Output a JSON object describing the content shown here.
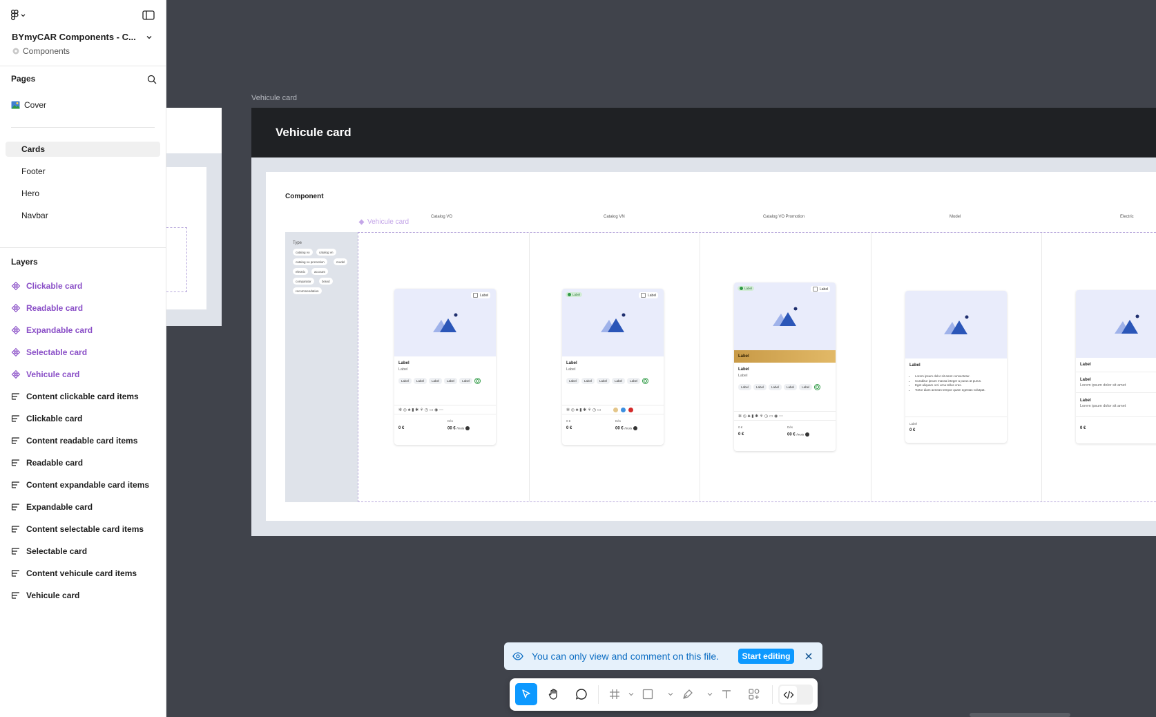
{
  "file": {
    "title": "BYmyCAR Components - C...",
    "subtitle": "Components"
  },
  "pages": {
    "header": "Pages",
    "items": [
      {
        "label": "Cover"
      },
      {
        "label": "Cards"
      },
      {
        "label": "Footer"
      },
      {
        "label": "Hero"
      },
      {
        "label": "Navbar"
      }
    ]
  },
  "layers": {
    "header": "Layers",
    "items": [
      {
        "label": "Clickable card",
        "kind": "component"
      },
      {
        "label": "Readable card",
        "kind": "component"
      },
      {
        "label": "Expandable card",
        "kind": "component"
      },
      {
        "label": "Selectable card",
        "kind": "component"
      },
      {
        "label": "Vehicule card",
        "kind": "component"
      },
      {
        "label": "Content clickable card items",
        "kind": "frame"
      },
      {
        "label": "Clickable card",
        "kind": "frame"
      },
      {
        "label": "Content readable card items",
        "kind": "frame"
      },
      {
        "label": "Readable card",
        "kind": "frame"
      },
      {
        "label": "Content expandable card items",
        "kind": "frame"
      },
      {
        "label": "Expandable card",
        "kind": "frame"
      },
      {
        "label": "Content selectable card items",
        "kind": "frame"
      },
      {
        "label": "Selectable card",
        "kind": "frame"
      },
      {
        "label": "Content vehicule card items",
        "kind": "frame"
      },
      {
        "label": "Vehicule card",
        "kind": "frame"
      }
    ]
  },
  "canvas": {
    "frame_label": "Vehicule card",
    "frame_title": "Vehicule card",
    "component_label": "Component",
    "variant_label": "Vehicule card",
    "columns": [
      "Catalog VO",
      "Catalog VN",
      "Catalog VO Promotion",
      "Model",
      "Electric"
    ],
    "type_panel": {
      "title": "Type",
      "chips": [
        "catalog vo",
        "catalog vn",
        "catalog vo promotion",
        "model",
        "electric",
        "account",
        "comparator",
        "brand",
        "recommendation"
      ]
    },
    "cards": {
      "label": "Label",
      "sublabel": "Label",
      "chip": "Label",
      "checkbox_label": "Label",
      "badge": "Label",
      "promo": "Label",
      "price": "0 €",
      "price_from_label": "Dès",
      "price_monthly": "00 €",
      "per_month": "/mois",
      "price_small_label": "0 €",
      "model_bullets": [
        "Lorem ipsum dolor sit amet consectetur.",
        "Curabitur ipsum massa integer a purus at purus.",
        "Eget aliquam orci urna tellus cras.",
        "Tortor diam aenean tempor quam egestas volutpat."
      ],
      "electric_item_text": "Lorem ipsum dolor sit amet",
      "colors": [
        "#e4c68a",
        "#3d8fe0",
        "#d42a2a"
      ]
    }
  },
  "banner": {
    "text": "You can only view and comment on this file.",
    "button": "Start editing"
  },
  "toolbar": {
    "tools": [
      "move-tool",
      "hand-tool",
      "comment-tool",
      "frame-tool",
      "shape-tool",
      "pen-tool",
      "text-tool",
      "resources-tool",
      "dev-mode-toggle"
    ]
  }
}
